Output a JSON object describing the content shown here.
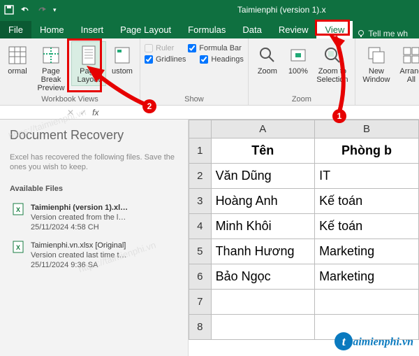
{
  "title": "Taimienphi (version 1).x",
  "tabs": {
    "file": "File",
    "home": "Home",
    "insert": "Insert",
    "page_layout": "Page Layout",
    "formulas": "Formulas",
    "data": "Data",
    "review": "Review",
    "view": "View",
    "tell": "Tell me wh"
  },
  "ribbon": {
    "views": {
      "normal": "ormal",
      "page_break": "Page Break\nPreview",
      "page_layout": "Page\nLayout",
      "custom": "ustom",
      "group": "Workbook Views"
    },
    "show": {
      "ruler": "Ruler",
      "formula_bar": "Formula Bar",
      "gridlines": "Gridlines",
      "headings": "Headings",
      "group": "Show"
    },
    "zoom": {
      "zoom": "Zoom",
      "hundred": "100%",
      "zts": "Zoom to\nSelection",
      "group": "Zoom"
    },
    "window": {
      "new_window": "New\nWindow",
      "arrange": "Arrang\nAll"
    }
  },
  "recovery": {
    "title": "Document Recovery",
    "sub": "Excel has recovered the following files. Save the ones you wish to keep.",
    "avail": "Available Files",
    "files": [
      {
        "name": "Taimienphi (version 1).xl…",
        "line1": "Version created from the l…",
        "line2": "25/11/2024 4:58 CH"
      },
      {
        "name": "Taimienphi.vn.xlsx  [Original]",
        "line1": "Version created last time t…",
        "line2": "25/11/2024 9:36 SA"
      }
    ]
  },
  "sheet": {
    "cols": [
      "A",
      "B"
    ],
    "headers": [
      "Tên",
      "Phòng b"
    ],
    "rows": [
      [
        "Văn Dũng",
        "IT"
      ],
      [
        "Hoàng Anh",
        "Kế toán"
      ],
      [
        "Minh Khôi",
        "Kế toán"
      ],
      [
        "Thanh Hương",
        "Marketing"
      ],
      [
        "Bảo Ngọc",
        "Marketing"
      ]
    ]
  },
  "annotations": {
    "n1": "1",
    "n2": "2"
  },
  "watermark": "https://taimienphi.vn",
  "logo": {
    "t": "t",
    "rest": "aimienphi.vn"
  }
}
